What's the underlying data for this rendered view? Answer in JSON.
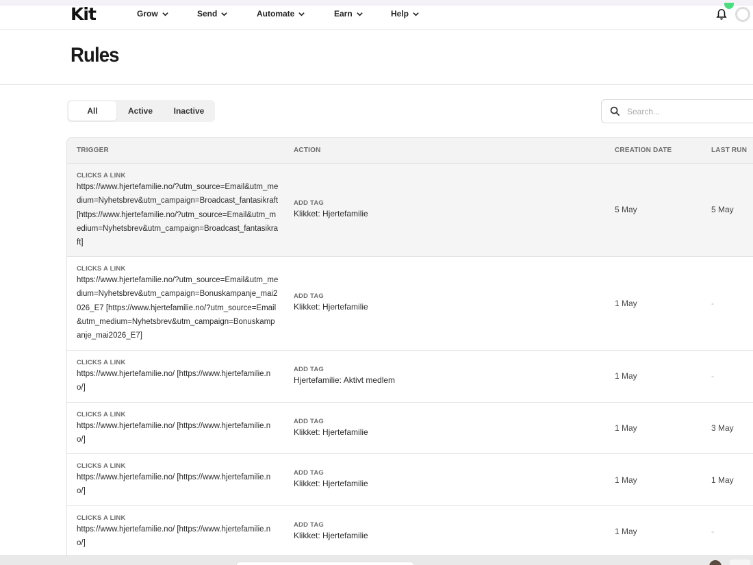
{
  "nav": {
    "logo": "Kit",
    "items": [
      "Grow",
      "Send",
      "Automate",
      "Earn",
      "Help"
    ]
  },
  "page": {
    "title": "Rules"
  },
  "filters": {
    "all": "All",
    "active": "Active",
    "inactive": "Inactive",
    "selected": "All"
  },
  "search": {
    "placeholder": "Search..."
  },
  "table": {
    "headers": {
      "trigger": "TRIGGER",
      "action": "ACTION",
      "creation_date": "CREATION DATE",
      "last_run": "LAST RUN"
    },
    "rows": [
      {
        "trigger_type": "CLICKS A LINK",
        "trigger_url": "https://www.hjertefamilie.no/?utm_source=Email&utm_medium=Nyhetsbrev&utm_campaign=Broadcast_fantasikraft [https://www.hjertefamilie.no/?utm_source=Email&utm_medium=Nyhetsbrev&utm_campaign=Broadcast_fantasikraft]",
        "action_type": "ADD TAG",
        "action_value": "Klikket: Hjertefamilie",
        "creation_date": "5 May",
        "last_run": "5 May"
      },
      {
        "trigger_type": "CLICKS A LINK",
        "trigger_url": "https://www.hjertefamilie.no/?utm_source=Email&utm_medium=Nyhetsbrev&utm_campaign=Bonuskampanje_mai2026_E7 [https://www.hjertefamilie.no/?utm_source=Email&utm_medium=Nyhetsbrev&utm_campaign=Bonuskampanje_mai2026_E7]",
        "action_type": "ADD TAG",
        "action_value": "Klikket: Hjertefamilie",
        "creation_date": "1 May",
        "last_run": "-"
      },
      {
        "trigger_type": "CLICKS A LINK",
        "trigger_url": "https://www.hjertefamilie.no/ [https://www.hjertefamilie.no/]",
        "action_type": "ADD TAG",
        "action_value": "Hjertefamilie: Aktivt medlem",
        "creation_date": "1 May",
        "last_run": "-"
      },
      {
        "trigger_type": "CLICKS A LINK",
        "trigger_url": "https://www.hjertefamilie.no/ [https://www.hjertefamilie.no/]",
        "action_type": "ADD TAG",
        "action_value": "Klikket: Hjertefamilie",
        "creation_date": "1 May",
        "last_run": "3 May"
      },
      {
        "trigger_type": "CLICKS A LINK",
        "trigger_url": "https://www.hjertefamilie.no/ [https://www.hjertefamilie.no/]",
        "action_type": "ADD TAG",
        "action_value": "Klikket: Hjertefamilie",
        "creation_date": "1 May",
        "last_run": "1 May"
      },
      {
        "trigger_type": "CLICKS A LINK",
        "trigger_url": "https://www.hjertefamilie.no/ [https://www.hjertefamilie.no/]",
        "action_type": "ADD TAG",
        "action_value": "Klikket: Hjertefamilie",
        "creation_date": "1 May",
        "last_run": "-"
      }
    ]
  },
  "colors": {
    "notification_dot": "#4ade80",
    "header_bg": "#f3f3f4",
    "border": "#e2e2e2"
  }
}
